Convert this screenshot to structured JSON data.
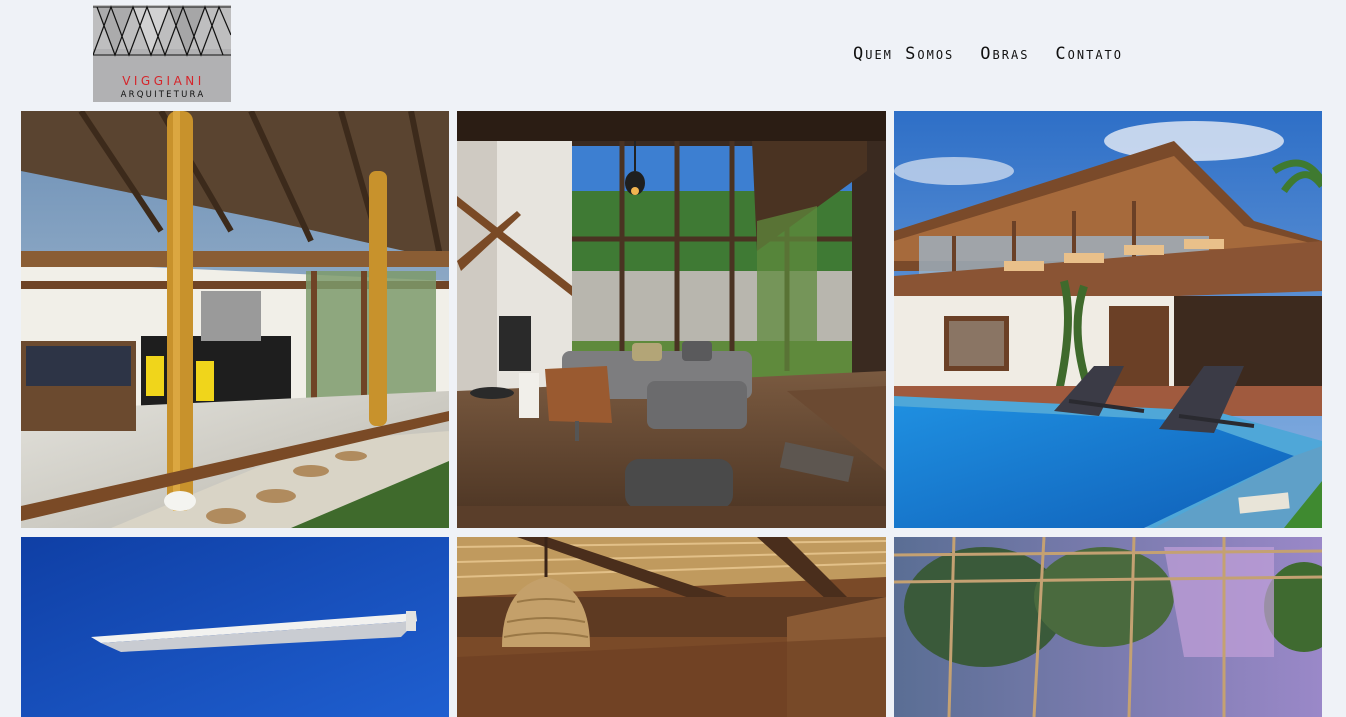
{
  "brand": {
    "name": "VIGGIANI",
    "subtitle": "ARQUITETURA",
    "logo_icon": "triangles-logo-icon",
    "accent_color": "#d5252b",
    "logo_bg": "#b1b1b3"
  },
  "nav": {
    "items": [
      {
        "label": "Quem Somos"
      },
      {
        "label": "Obras"
      },
      {
        "label": "Contato"
      }
    ]
  },
  "gallery": {
    "photos": [
      {
        "subject": "covered-veranda-photo"
      },
      {
        "subject": "living-room-photo"
      },
      {
        "subject": "pool-house-photo"
      },
      {
        "subject": "white-roof-sky-photo"
      },
      {
        "subject": "wicker-pendant-photo"
      },
      {
        "subject": "glass-pergola-photo"
      }
    ]
  }
}
